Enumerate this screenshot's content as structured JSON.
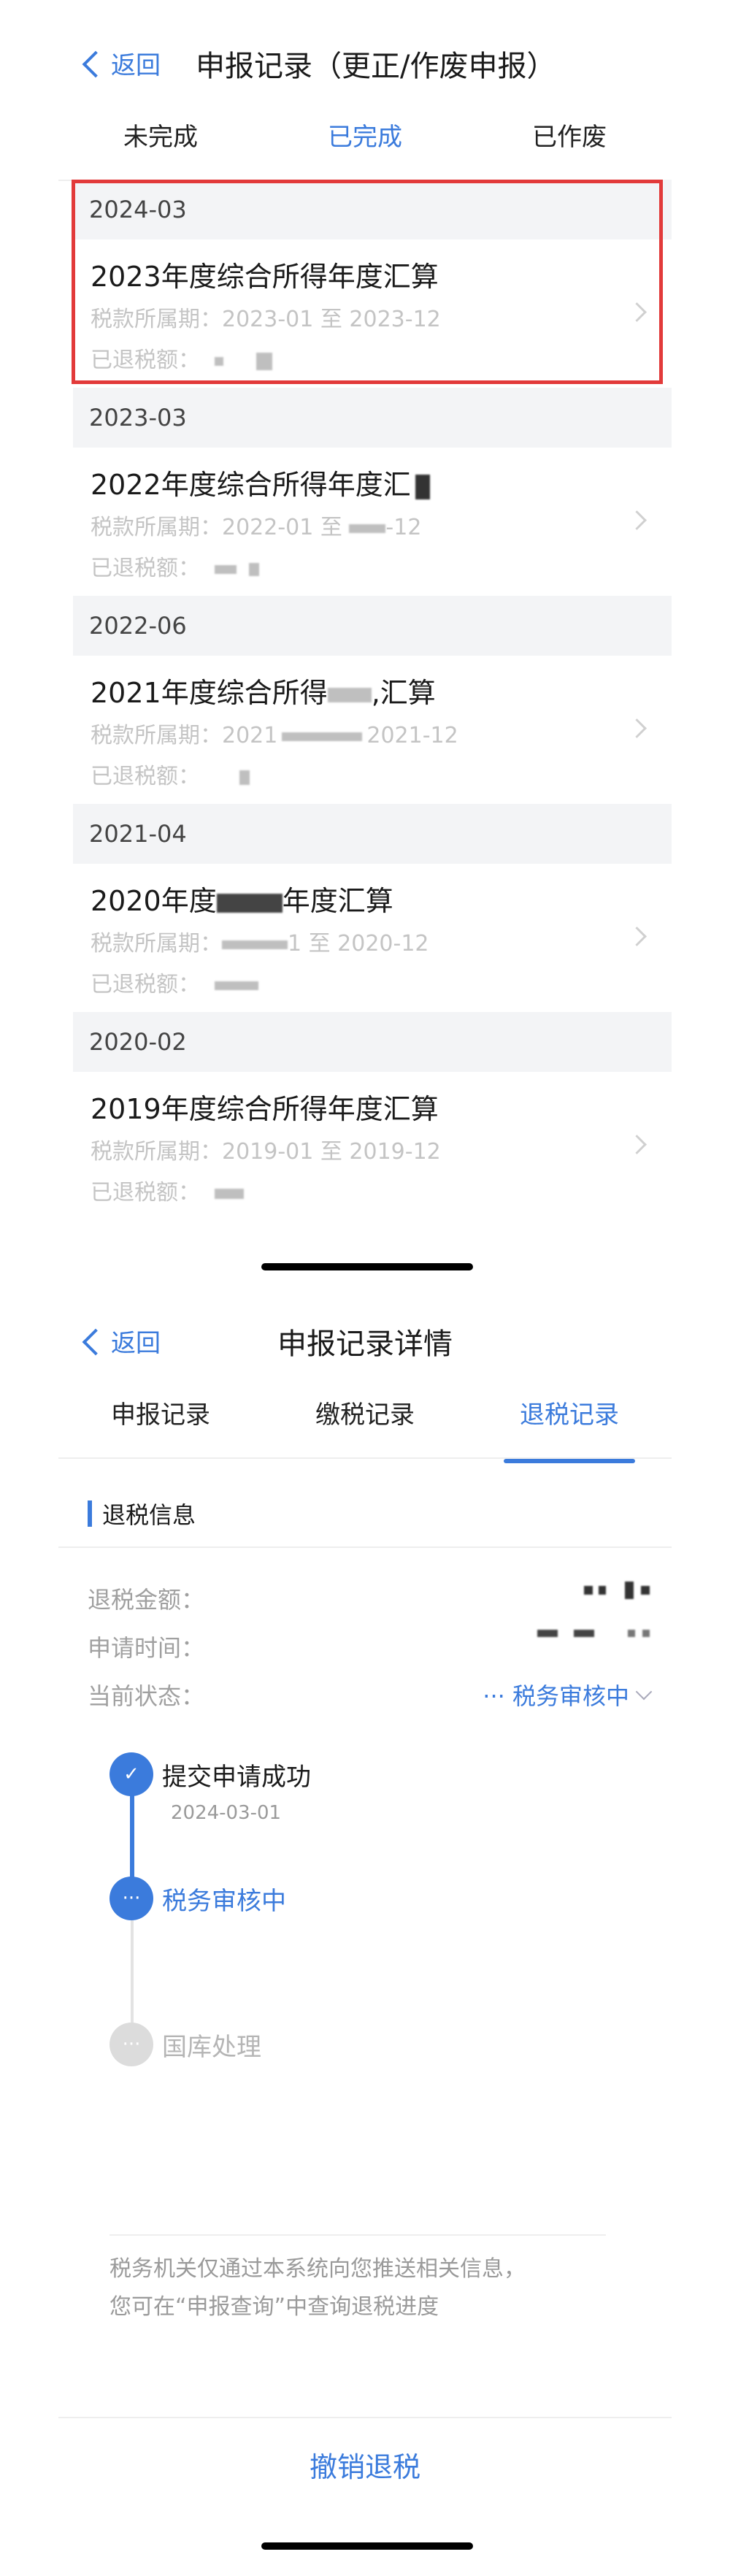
{
  "screen1": {
    "back_label": "返回",
    "title": "申报记录（更正/作废申报）",
    "tabs": [
      {
        "label": "未完成"
      },
      {
        "label": "已完成"
      },
      {
        "label": "已作废"
      }
    ],
    "active_tab": "已完成",
    "groups": [
      {
        "date": "2024-03",
        "title": "2023年度综合所得年度汇算",
        "period": "税款所属期：2023-01 至 2023-12",
        "refund_label": "已退税额："
      },
      {
        "date": "2023-03",
        "title": "2022年度综合所得年度汇",
        "period": "税款所属期：2022-01 至 ",
        "refund_label": "已退税额："
      },
      {
        "date": "2022-06",
        "title": "2021年度综合所得",
        "period": "税款所属期：2021",
        "refund_label": "已退税额："
      },
      {
        "date": "2021-04",
        "title": "2020年度",
        "period": "税款所属期：",
        "refund_label": "已退税额："
      },
      {
        "date": "2020-02",
        "title": "2019年度综合所得年度汇算",
        "period": "税款所属期：2019-01 至 2019-12",
        "refund_label": "已退税额："
      }
    ],
    "extra": {
      "r2_title_tail": "",
      "r2_period_tail": "-12",
      "r3_title_tail": ",汇算",
      "r3_period_tail": "2021-12",
      "r4_title_tail": "年度汇算",
      "r4_period_tail": "1 至 2020-12"
    }
  },
  "screen2": {
    "back_label": "返回",
    "title": "申报记录详情",
    "tabs": [
      {
        "label": "申报记录"
      },
      {
        "label": "缴税记录"
      },
      {
        "label": "退税记录"
      }
    ],
    "active_tab": "退税记录",
    "section_title": "退税信息",
    "rows": [
      {
        "label": "退税金额："
      },
      {
        "label": "申请时间："
      },
      {
        "label": "当前状态：",
        "value": "··· 税务审核中"
      }
    ],
    "timeline": [
      {
        "label": "提交申请成功",
        "date": "2024-03-01",
        "status": "done",
        "icon": "check-icon"
      },
      {
        "label": "税务审核中",
        "status": "current",
        "icon": "ellipsis-icon"
      },
      {
        "label": "国库处理",
        "status": "pending",
        "icon": "ellipsis-icon"
      }
    ],
    "notice_line1": "税务机关仅通过本系统向您推送相关信息，",
    "notice_line2": "您可在“申报查询”中查询退税进度",
    "cancel_label": "撤销退税"
  },
  "colors": {
    "accent": "#3b7bdc",
    "highlight": "#e23a3a"
  }
}
